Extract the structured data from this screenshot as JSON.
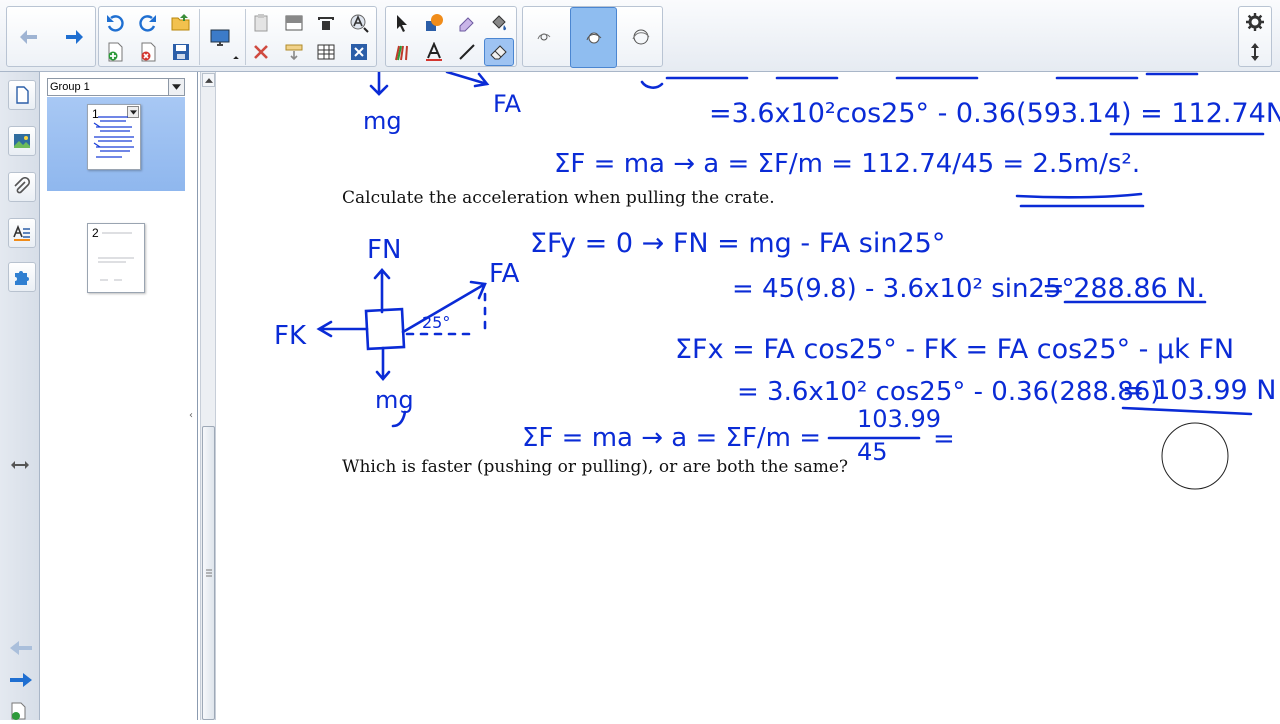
{
  "toolbar": {
    "groups": [
      "navigation",
      "edit",
      "drawing",
      "pen-mode",
      "settings"
    ],
    "buttons": [
      "back-button",
      "forward-button",
      "undo-button",
      "redo-button",
      "open-button",
      "add-page-button",
      "delete-page-button",
      "save-button",
      "display-button",
      "paste-button",
      "screen-shade-button",
      "capture-button",
      "text-tool-button",
      "handwriting-button",
      "delete-button",
      "insert-button",
      "table-button",
      "close-x-button",
      "select-tool-button",
      "shape-tool-button",
      "eraser-color-button",
      "fill-tool-button",
      "creative-pen-button",
      "text-button",
      "line-button",
      "eraser-button",
      "pen-mode-1-button",
      "pen-mode-2-button",
      "pen-mode-3-button",
      "gear-button",
      "move-toolbar-button"
    ],
    "accent": "#1f6fd1"
  },
  "sorter": {
    "group_label": "Group 1",
    "pages": [
      {
        "number": "1"
      },
      {
        "number": "2"
      }
    ],
    "selected_color": "#9bbef0"
  },
  "canvas": {
    "prompts": [
      "Calculate the acceleration when pulling the crate.",
      "Which is faster (pushing or pulling), or are both the same?"
    ],
    "ink_color": "#0a2bd6",
    "ink": {
      "top_mg": "mg",
      "top_fa": "FA",
      "top_line_eq": "=3.6x10²cos25° - 0.36(593.14) = 112.74N.",
      "top_newton": "ΣF = ma  →  a = ΣF/m = 112.74/45 = 2.5m/s².",
      "top_numerator": "112.74",
      "top_denominator": "45",
      "top_result": "2.5m/s².",
      "fn": "FN",
      "fa": "FA",
      "fk": "FK",
      "angle": "25°",
      "mg": "mg",
      "sum_fy": "ΣFy = 0  →  FN = mg - FA sin25°",
      "fn_calc": "= 45(9.8) - 3.6x10² sin25°",
      "fn_result": "= 288.86 N.",
      "sum_fx": "ΣFx = FA cos25° - FK = FA cos25° - μk FN",
      "fx_calc": "= 3.6x10² cos25° - 0.36(288.86)",
      "fx_result": "= 103.99 N",
      "newton": "ΣF = ma  →  a = ΣF/m = ",
      "numerator": "103.99",
      "denominator": "45",
      "equals": "="
    }
  }
}
